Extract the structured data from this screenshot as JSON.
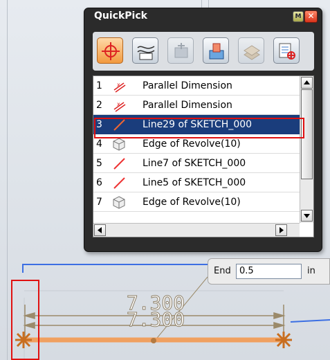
{
  "quickpick": {
    "title": "QuickPick",
    "minimize_glyph": "M",
    "close_glyph": "✕",
    "filters": [
      {
        "icon": "crosshair-point-icon",
        "state": "active"
      },
      {
        "icon": "curve-icon",
        "state": "normal"
      },
      {
        "icon": "face-icon",
        "state": "disabled"
      },
      {
        "icon": "solid-body-icon",
        "state": "normal"
      },
      {
        "icon": "sheet-body-icon",
        "state": "disabled"
      },
      {
        "icon": "feature-list-icon",
        "state": "normal"
      }
    ],
    "items": [
      {
        "index": "1",
        "label": "Parallel Dimension",
        "icon": "parallel-dimension-icon"
      },
      {
        "index": "2",
        "label": "Parallel Dimension",
        "icon": "parallel-dimension-icon"
      },
      {
        "index": "3",
        "label": "Line29 of SKETCH_000",
        "icon": "sketch-line-icon",
        "selected": true
      },
      {
        "index": "4",
        "label": "Edge of Revolve(10)",
        "icon": "revolve-edge-icon"
      },
      {
        "index": "5",
        "label": "Line7 of SKETCH_000",
        "icon": "sketch-line-icon"
      },
      {
        "index": "6",
        "label": "Line5 of SKETCH_000",
        "icon": "sketch-line-icon"
      },
      {
        "index": "7",
        "label": "Edge of Revolve(10)",
        "icon": "revolve-edge-icon"
      }
    ]
  },
  "end_input": {
    "label": "End",
    "value": "0.5",
    "unit": "in"
  },
  "dimensions": {
    "upper": "7.300",
    "lower": "7.300"
  },
  "colors": {
    "selection": "#1a3d7c",
    "highlight_box": "#e01010",
    "sketch_line": "#f0a060",
    "dimension": "#9b8a6a"
  }
}
